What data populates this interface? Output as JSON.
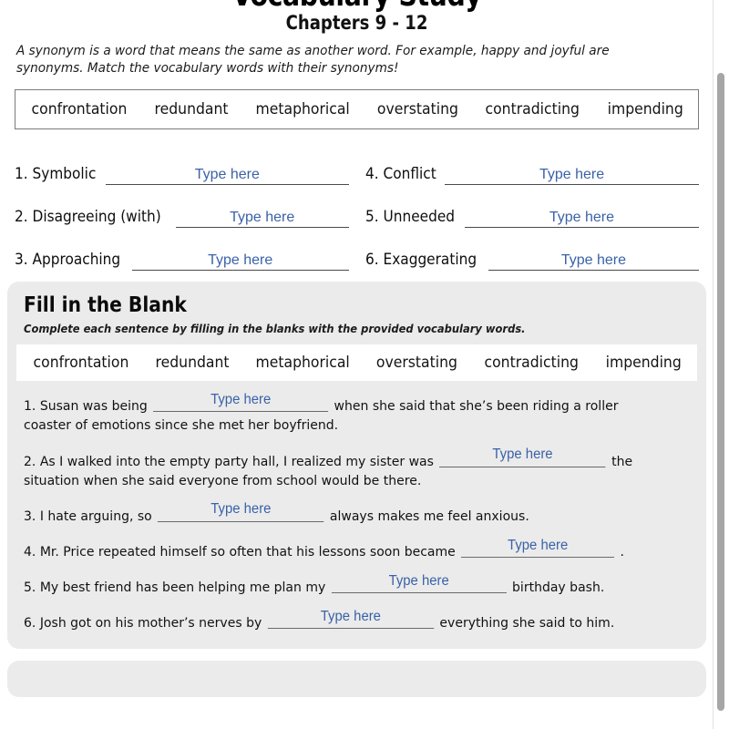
{
  "header": {
    "title": "Vocabulary Study",
    "subtitle": "Chapters 9 - 12",
    "intro": "A synonym is a word that means the same as another word. For example, happy and joyful are synonyms. Match the vocabulary words with their synonyms!"
  },
  "word_bank": {
    "words": [
      "confrontation",
      "redundant",
      "metaphorical",
      "overstating",
      "contradicting",
      "impending"
    ]
  },
  "matching": {
    "items": [
      {
        "label": "1. Symbolic",
        "placeholder": "Type here"
      },
      {
        "label": "4. Conflict",
        "placeholder": "Type here"
      },
      {
        "label": "2. Disagreeing (with)",
        "placeholder": "Type here"
      },
      {
        "label": "5. Unneeded",
        "placeholder": "Type here"
      },
      {
        "label": "3. Approaching",
        "placeholder": "Type here"
      },
      {
        "label": "6. Exaggerating",
        "placeholder": "Type here"
      }
    ]
  },
  "fill_section": {
    "heading": "Fill in the Blank",
    "subheading": "Complete each sentence by filling in the blanks with the provided vocabulary words.",
    "word_bank": [
      "confrontation",
      "redundant",
      "metaphorical",
      "overstating",
      "contradicting",
      "impending"
    ],
    "questions": [
      {
        "before": "1. Susan was being",
        "placeholder": "Type here",
        "after": "when she said that she’s been riding a roller coaster of emotions since she met her boyfriend."
      },
      {
        "before": "2. As I walked into the empty party hall, I realized my sister was",
        "placeholder": "Type here",
        "after": "the situation when she said everyone from school would be there."
      },
      {
        "before": "3. I hate arguing, so",
        "placeholder": "Type here",
        "after": "always makes me feel anxious."
      },
      {
        "before": "4. Mr. Price repeated himself so often that his lessons soon became",
        "placeholder": "Type here",
        "after": "."
      },
      {
        "before": "5. My best friend has been helping me plan my",
        "placeholder": "Type here",
        "after": "birthday bash."
      },
      {
        "before": "6. Josh got on his mother’s nerves by",
        "placeholder": "Type here",
        "after": "everything she said to him."
      }
    ]
  },
  "colors": {
    "hint_blue": "#3a62a8",
    "panel_gray": "#ebebeb",
    "rule_gray": "#6a6a6a",
    "scrollbar_thumb": "#a6a6a6"
  }
}
